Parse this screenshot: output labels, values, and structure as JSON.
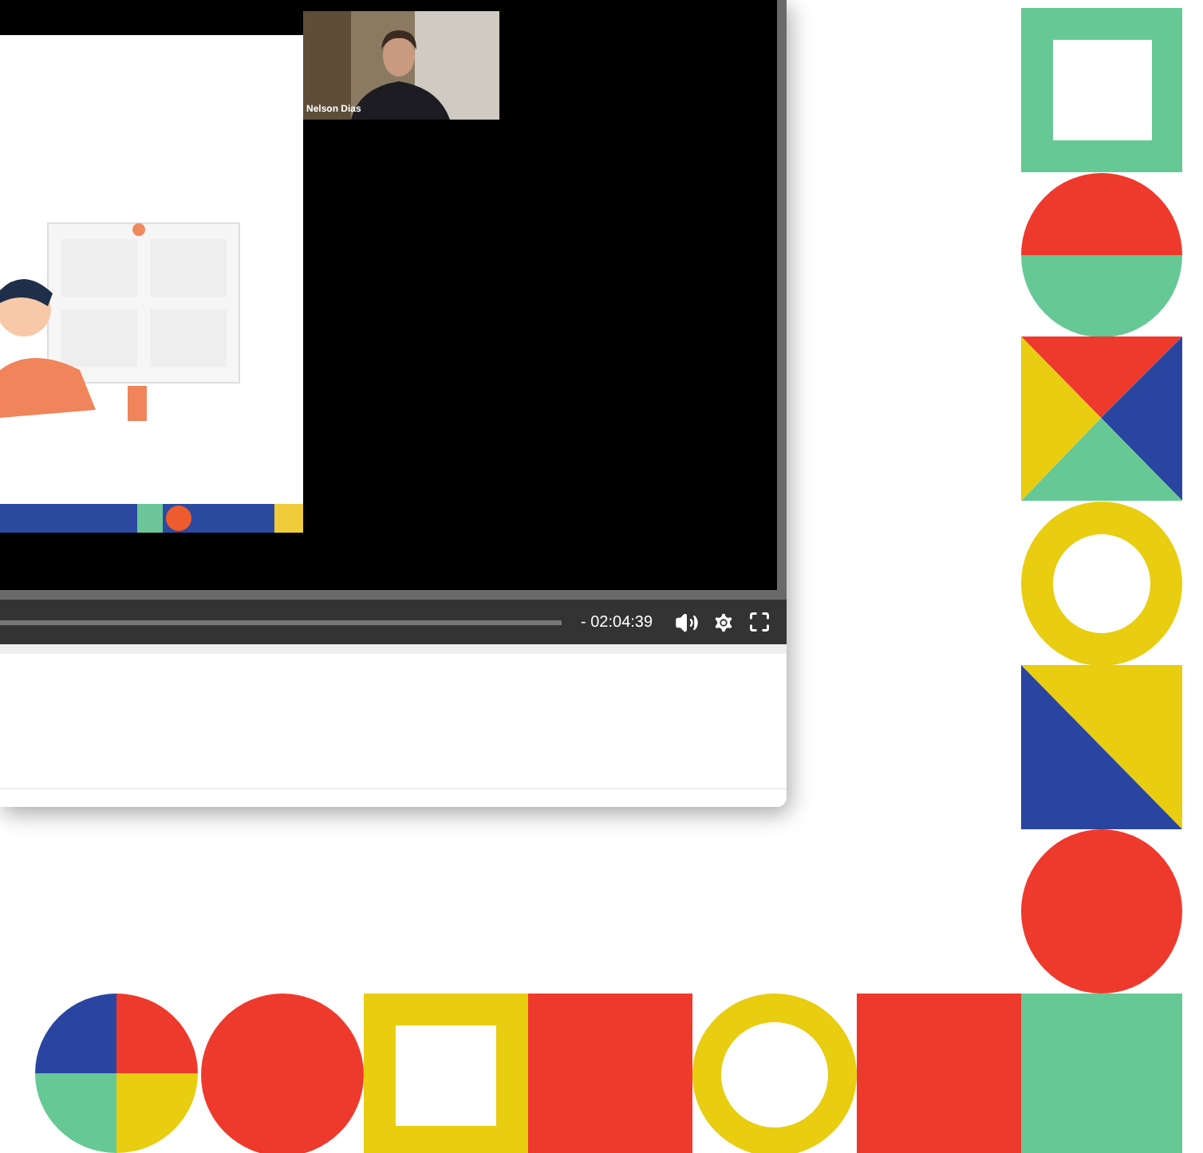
{
  "video": {
    "camera": {
      "kind": "picture",
      "name_tag": "Nelson Dias"
    }
  },
  "controls": {
    "remaining_time": "- 02:04:39",
    "buttons": [
      {
        "kind": "volume"
      },
      {
        "kind": "settings"
      },
      {
        "kind": "fullscreen"
      }
    ]
  }
}
